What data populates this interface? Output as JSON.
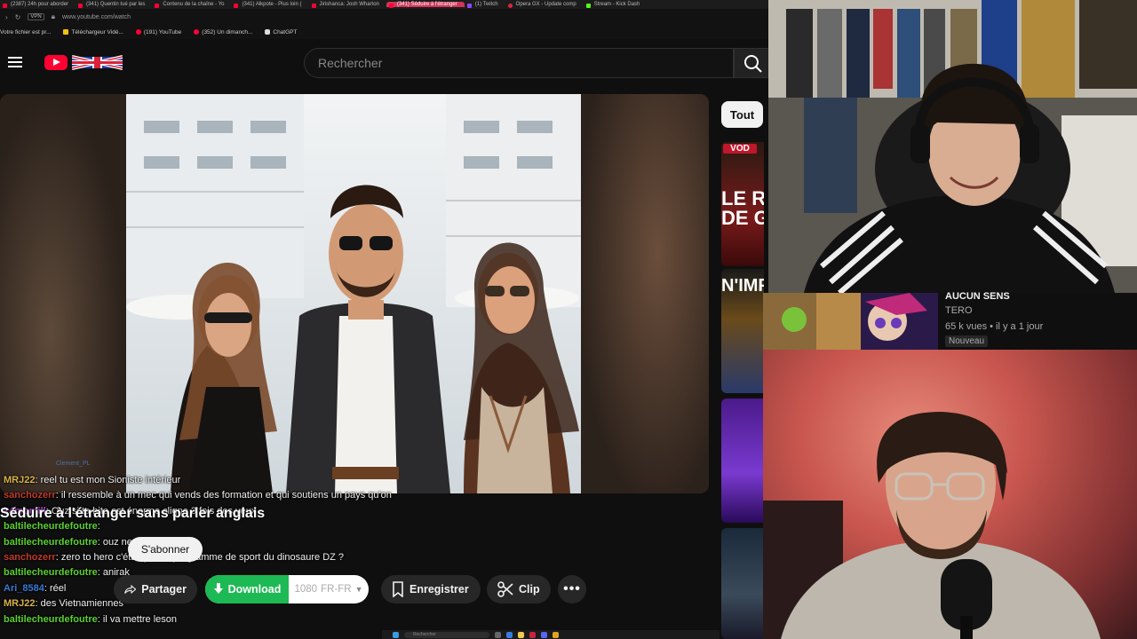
{
  "browser": {
    "tabs": [
      {
        "label": "(2387) 24h pour aborder",
        "kind": "yt"
      },
      {
        "label": "(341) Quentin tué par les",
        "kind": "yt"
      },
      {
        "label": "Contenu de la chaîne - Yo",
        "kind": "yt"
      },
      {
        "label": "(341) Alkpote - Plus loin (",
        "kind": "yt"
      },
      {
        "label": "Jirishanca: Josh Wharton",
        "kind": "yt"
      },
      {
        "label": "(341) Séduire à l'étranger",
        "kind": "yt",
        "active": true
      },
      {
        "label": "(1) Twitch",
        "kind": "twitch"
      },
      {
        "label": "Opera GX - Update comp",
        "kind": "opera"
      },
      {
        "label": "Stream - Kick Dash",
        "kind": "kick"
      }
    ],
    "vpn_label": "VPN",
    "url": "www.youtube.com/watch",
    "bookmarks": [
      {
        "label": "Votre fichier est pr...",
        "icon": "none"
      },
      {
        "label": "Téléchargeur Vidé...",
        "icon": "yellow"
      },
      {
        "label": "(191) YouTube",
        "icon": "red"
      },
      {
        "label": "(352) Un dimanch...",
        "icon": "red"
      },
      {
        "label": "ChatGPT",
        "icon": "gpt"
      }
    ]
  },
  "header": {
    "search_placeholder": "Rechercher"
  },
  "video": {
    "title": "Séduire à l'étranger sans parler anglais",
    "subscribe_label": "S'abonner",
    "actions": {
      "share": "Partager",
      "download": "Download",
      "quality": "1080",
      "language": "FR-FR",
      "save": "Enregistrer",
      "clip": "Clip"
    }
  },
  "chat": {
    "top_user": "Clement_PL",
    "messages": [
      {
        "user": "MRJ22",
        "color": "#d9b44a",
        "text": "reel tu est mon Sioniste intérieur"
      },
      {
        "user": "sanchozerr",
        "color": "#c0392b",
        "text": "il ressemble à un mec qui vends des formation et qui soutiens un pays qu'on"
      },
      {
        "user": "k4momill",
        "color": "#b04ccf",
        "text": "Ouz si ta bite est énorme cligne 3 fois des yeux"
      },
      {
        "user": "baltilecheurdefoutre",
        "color": "#5bd12f",
        "text": ""
      },
      {
        "user": "baltilecheurdefoutre",
        "color": "#5bd12f",
        "text": "ouz ne"
      },
      {
        "user": "sanchozerr",
        "color": "#c0392b",
        "text": "zero to hero c'était pas le programme de sport du dinosaure DZ ?"
      },
      {
        "user": "baltilecheurdefoutre",
        "color": "#5bd12f",
        "text": "anirak"
      },
      {
        "user": "Ari_8584",
        "color": "#3a7bd5",
        "text": "réel"
      },
      {
        "user": "MRJ22",
        "color": "#d9b44a",
        "text": "des Vietnamiennes"
      },
      {
        "user": "baltilecheurdefoutre",
        "color": "#5bd12f",
        "text": "il va mettre leson"
      }
    ]
  },
  "sidebar": {
    "chip_label": "Tout",
    "thumbs": [
      {
        "label": "VOD",
        "color": "#c0172b"
      },
      {
        "label": "LE RET",
        "color": "#b3121f"
      },
      {
        "label": "DE GA",
        "color": "#b3121f"
      },
      {
        "label": "N'IMP",
        "color": "#222"
      }
    ]
  },
  "recommendation": {
    "title": "AUCUN SENS",
    "channel": "TERO",
    "meta": "65 k vues • il y a 1 jour",
    "badge": "Nouveau"
  },
  "taskbar": {
    "search_label": "Rechercher"
  }
}
